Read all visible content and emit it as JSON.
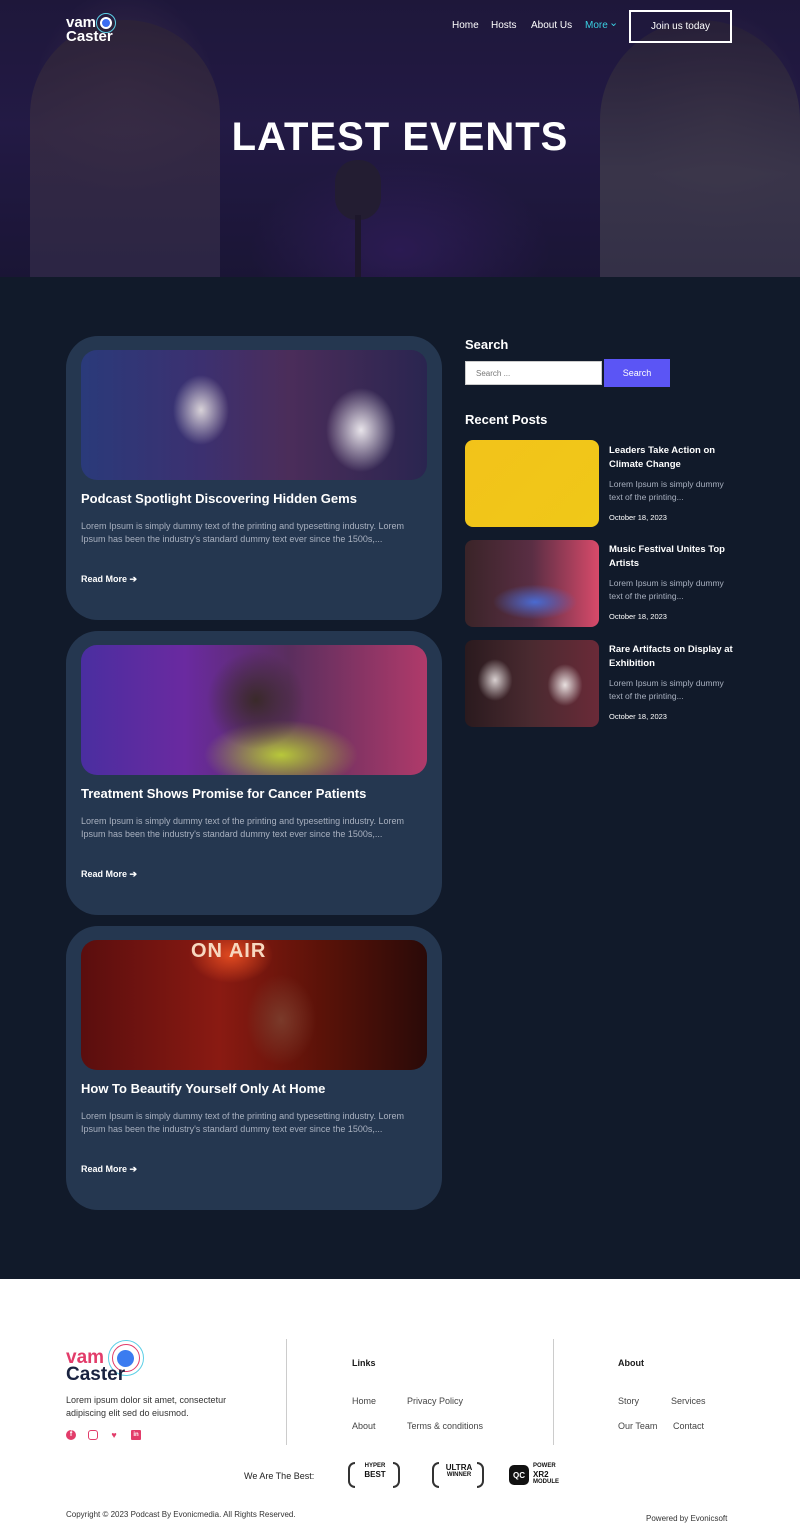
{
  "header": {
    "logo_top": "vam",
    "logo_bottom": "Caster",
    "nav": [
      {
        "label": "Home"
      },
      {
        "label": "Hosts"
      },
      {
        "label": "About Us"
      },
      {
        "label": "More"
      }
    ],
    "more_caret": "⌄",
    "cta_label": "Join us today",
    "accent_color": "#3ad1e3"
  },
  "hero": {
    "title": "LATEST EVENTS"
  },
  "posts": [
    {
      "title": "Podcast Spotlight Discovering Hidden Gems",
      "excerpt": "Lorem Ipsum is simply dummy text of the printing and typesetting industry. Lorem Ipsum has been the industry's standard dummy text ever since the 1500s,...",
      "read_more": "Read More"
    },
    {
      "title": "Treatment Shows Promise for Cancer Patients",
      "excerpt": "Lorem Ipsum is simply dummy text of the printing and typesetting industry. Lorem Ipsum has been the industry's standard dummy text ever since the 1500s,...",
      "read_more": "Read More"
    },
    {
      "title": "How To Beautify Yourself Only At Home",
      "excerpt": "Lorem Ipsum is simply dummy text of the printing and typesetting industry. Lorem Ipsum has been the industry's standard dummy text ever since the 1500s,...",
      "read_more": "Read More",
      "image_sign": "ON AIR"
    }
  ],
  "sidebar": {
    "search_heading": "Search",
    "search_placeholder": "Search ...",
    "search_button": "Search",
    "search_button_color": "#5b55f5",
    "recent_heading": "Recent Posts",
    "recent": [
      {
        "title": "Leaders Take Action on Climate Change",
        "excerpt": "Lorem Ipsum is simply dummy text of the printing...",
        "date": "October 18, 2023"
      },
      {
        "title": "Music Festival Unites Top Artists",
        "excerpt": "Lorem Ipsum is simply dummy text of the printing...",
        "date": "October 18, 2023"
      },
      {
        "title": "Rare Artifacts on Display at Exhibition",
        "excerpt": "Lorem Ipsum is simply dummy text of the printing...",
        "date": "October 18, 2023"
      }
    ]
  },
  "footer": {
    "logo_top": "vam",
    "logo_bottom": "Caster",
    "description": "Lorem ipsum dolor sit amet, consectetur adipiscing elit  sed do eiusmod.",
    "social_icons": [
      "facebook-icon",
      "instagram-icon",
      "twitter-icon",
      "linkedin-icon"
    ],
    "links_heading": "Links",
    "links": [
      "Home",
      "Privacy Policy",
      "About",
      "Terms & conditions"
    ],
    "about_heading": "About",
    "about_links": [
      "Story",
      "Services",
      "Our Team",
      "Contact"
    ],
    "best_label": "We Are The Best:",
    "awards": [
      {
        "line1": "HYPER",
        "line2": "BEST"
      },
      {
        "line1": "ULTRA",
        "line2": "WINNER"
      },
      {
        "line1": "POWER",
        "line2": "XR2",
        "line3": "MODULE",
        "badge": "QC"
      }
    ],
    "copyright": "Copyright © 2023 Podcast By Evonicmedia. All Rights Reserved.",
    "powered": "Powered by Evonicsoft",
    "brand_color": "#e23c6a"
  }
}
